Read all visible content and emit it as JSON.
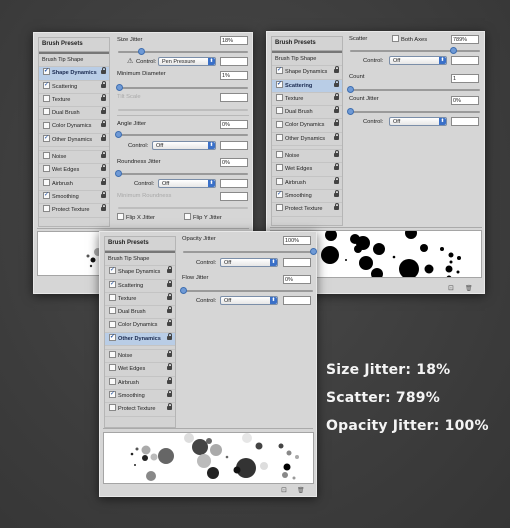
{
  "panels": [
    {
      "id": "shape-dynamics",
      "sidebar": {
        "presets": "Brush Presets",
        "tip_shape": "Brush Tip Shape",
        "items": [
          {
            "label": "Shape Dynamics",
            "checked": true,
            "selected": true
          },
          {
            "label": "Scattering",
            "checked": true,
            "selected": false
          },
          {
            "label": "Texture",
            "checked": false,
            "selected": false
          },
          {
            "label": "Dual Brush",
            "checked": false,
            "selected": false
          },
          {
            "label": "Color Dynamics",
            "checked": false,
            "selected": false
          },
          {
            "label": "Other Dynamics",
            "checked": true,
            "selected": false
          },
          {
            "label": "Noise",
            "checked": false,
            "selected": false
          },
          {
            "label": "Wet Edges",
            "checked": false,
            "selected": false
          },
          {
            "label": "Airbrush",
            "checked": false,
            "selected": false
          },
          {
            "label": "Smoothing",
            "checked": true,
            "selected": false
          },
          {
            "label": "Protect Texture",
            "checked": false,
            "selected": false
          }
        ]
      },
      "size_jitter": {
        "label": "Size Jitter",
        "value": "18%",
        "slider": 0.18
      },
      "control1": {
        "label": "Control:",
        "value": "Pen Pressure"
      },
      "min_diameter": {
        "label": "Minimum Diameter",
        "value": "1%",
        "slider": 0.01
      },
      "tilt_scale": {
        "label": "Tilt Scale",
        "value": ""
      },
      "angle_jitter": {
        "label": "Angle Jitter",
        "value": "0%",
        "slider": 0
      },
      "control2": {
        "label": "Control:",
        "value": "Off"
      },
      "roundness_jitter": {
        "label": "Roundness Jitter",
        "value": "0%",
        "slider": 0
      },
      "control3": {
        "label": "Control:",
        "value": "Off"
      },
      "min_roundness": {
        "label": "Minimum Roundness",
        "value": ""
      },
      "flip_x": {
        "label": "Flip X Jitter",
        "checked": false
      },
      "flip_y": {
        "label": "Flip Y Jitter",
        "checked": false
      }
    },
    {
      "id": "scattering",
      "sidebar": {
        "presets": "Brush Presets",
        "tip_shape": "Brush Tip Shape",
        "items": [
          {
            "label": "Shape Dynamics",
            "checked": true,
            "selected": false
          },
          {
            "label": "Scattering",
            "checked": true,
            "selected": true
          },
          {
            "label": "Texture",
            "checked": false,
            "selected": false
          },
          {
            "label": "Dual Brush",
            "checked": false,
            "selected": false
          },
          {
            "label": "Color Dynamics",
            "checked": false,
            "selected": false
          },
          {
            "label": "Other Dynamics",
            "checked": false,
            "selected": false
          },
          {
            "label": "Noise",
            "checked": false,
            "selected": false
          },
          {
            "label": "Wet Edges",
            "checked": false,
            "selected": false
          },
          {
            "label": "Airbrush",
            "checked": false,
            "selected": false
          },
          {
            "label": "Smoothing",
            "checked": true,
            "selected": false
          },
          {
            "label": "Protect Texture",
            "checked": false,
            "selected": false
          }
        ]
      },
      "scatter": {
        "label": "Scatter",
        "both_axes": "Both Axes",
        "both_axes_checked": false,
        "value": "789%",
        "slider": 0.79
      },
      "control1": {
        "label": "Control:",
        "value": "Off"
      },
      "count": {
        "label": "Count",
        "value": "1",
        "slider": 0
      },
      "count_jitter": {
        "label": "Count Jitter",
        "value": "0%",
        "slider": 0
      },
      "control2": {
        "label": "Control:",
        "value": "Off"
      }
    },
    {
      "id": "other-dynamics",
      "sidebar": {
        "presets": "Brush Presets",
        "tip_shape": "Brush Tip Shape",
        "items": [
          {
            "label": "Shape Dynamics",
            "checked": true,
            "selected": false
          },
          {
            "label": "Scattering",
            "checked": true,
            "selected": false
          },
          {
            "label": "Texture",
            "checked": false,
            "selected": false
          },
          {
            "label": "Dual Brush",
            "checked": false,
            "selected": false
          },
          {
            "label": "Color Dynamics",
            "checked": false,
            "selected": false
          },
          {
            "label": "Other Dynamics",
            "checked": true,
            "selected": true
          },
          {
            "label": "Noise",
            "checked": false,
            "selected": false
          },
          {
            "label": "Wet Edges",
            "checked": false,
            "selected": false
          },
          {
            "label": "Airbrush",
            "checked": false,
            "selected": false
          },
          {
            "label": "Smoothing",
            "checked": true,
            "selected": false
          },
          {
            "label": "Protect Texture",
            "checked": false,
            "selected": false
          }
        ]
      },
      "opacity_jitter": {
        "label": "Opacity Jitter",
        "value": "100%",
        "slider": 1.0
      },
      "control1": {
        "label": "Control:",
        "value": "Off"
      },
      "flow_jitter": {
        "label": "Flow Jitter",
        "value": "0%",
        "slider": 0
      },
      "control2": {
        "label": "Control:",
        "value": "Off"
      }
    }
  ],
  "captions": [
    "Size Jitter: 18%",
    "Scatter: 789%",
    "Opacity Jitter: 100%"
  ],
  "icons": {
    "check": "✓",
    "warning": "⚠",
    "select_arrow": "⬍",
    "new_preset": "⊡",
    "trash": "🗑"
  }
}
